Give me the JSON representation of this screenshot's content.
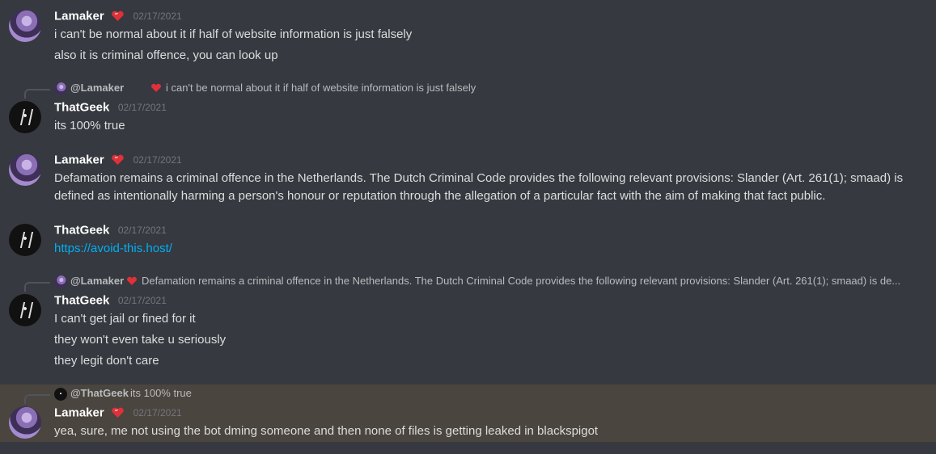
{
  "messages": [
    {
      "author": "Lamaker",
      "timestamp": "02/17/2021",
      "lines": [
        "i can't be normal about it if half of website information is just falsely",
        "also it is criminal offence, you can look up"
      ]
    },
    {
      "reply": {
        "author": "@Lamaker",
        "text": "i can't be normal about it if half of website information is just falsely"
      },
      "author": "ThatGeek",
      "timestamp": "02/17/2021",
      "lines": [
        "its 100% true"
      ]
    },
    {
      "author": "Lamaker",
      "timestamp": "02/17/2021",
      "text": "Defamation remains a criminal offence in the Netherlands. The Dutch Criminal Code provides the following relevant provisions: Slander (Art. 261(1); smaad) is defined as intentionally harming a person's honour or reputation through the allegation of a particular fact with the aim of making that fact public."
    },
    {
      "author": "ThatGeek",
      "timestamp": "02/17/2021",
      "link": "https://avoid-this.host/"
    },
    {
      "reply": {
        "author": "@Lamaker",
        "text": "Defamation remains a criminal offence in the Netherlands. The Dutch Criminal Code provides the following relevant provisions: Slander (Art. 261(1); smaad) is de..."
      },
      "author": "ThatGeek",
      "timestamp": "02/17/2021",
      "lines": [
        "I can't get jail or fined for it",
        "they won't even take u seriously",
        "they legit don't care"
      ]
    },
    {
      "reply": {
        "author": "@ThatGeek",
        "text": "its 100% true"
      },
      "author": "Lamaker",
      "timestamp": "02/17/2021",
      "lines": [
        "yea, sure, me not using the bot dming someone and then none of files is getting leaked in blackspigot"
      ]
    }
  ],
  "colors": {
    "background": "#36393f",
    "highlight": "#4a453e",
    "link": "#00aff4",
    "username": "#ffffff",
    "timestamp": "#72767d",
    "heart": "#e0303a"
  },
  "icons": {
    "heart": "red-heart-icon"
  }
}
